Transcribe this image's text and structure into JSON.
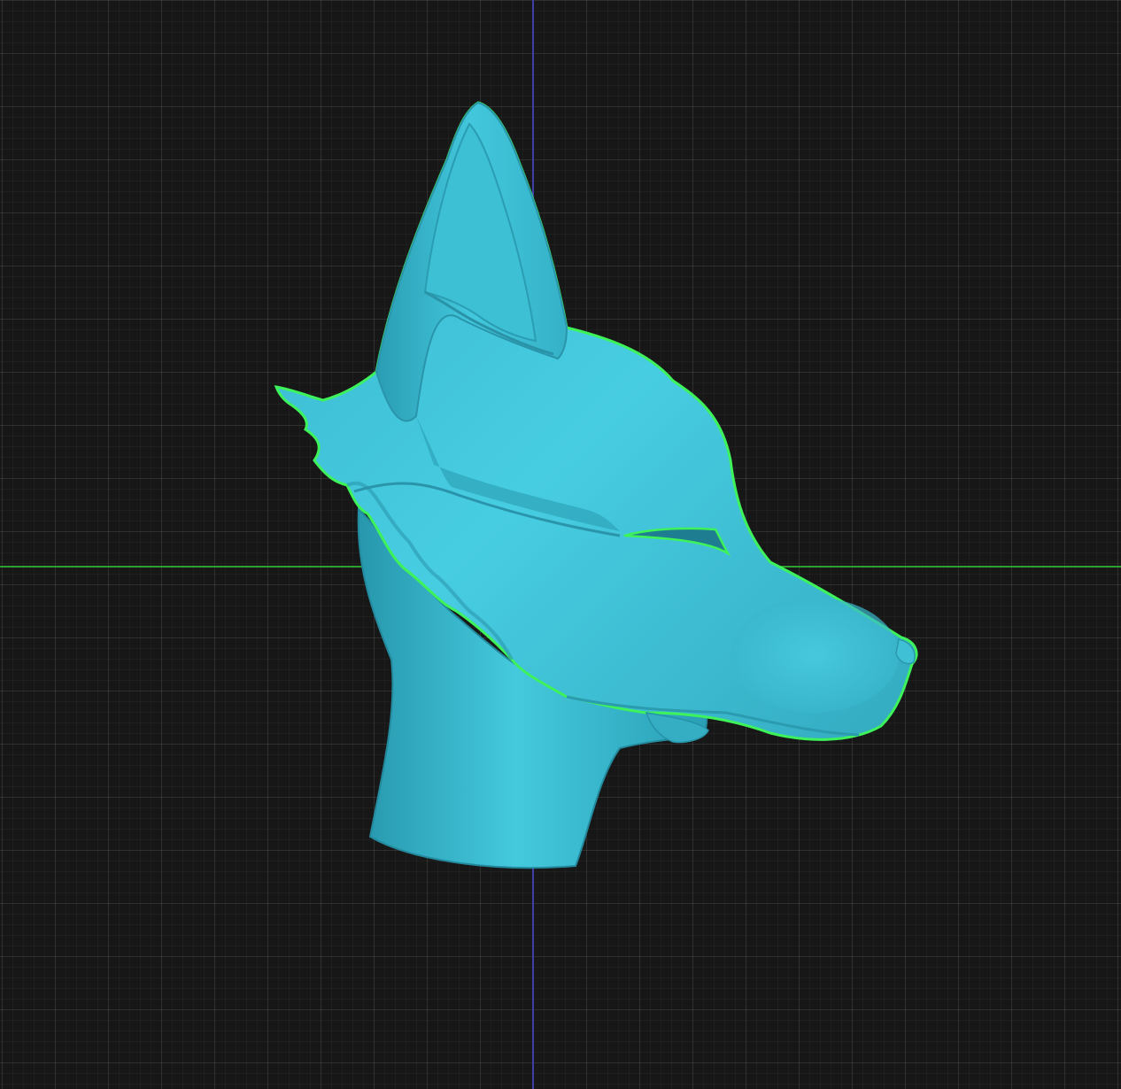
{
  "viewport": {
    "grid": true,
    "background_color": "#171717",
    "x_axis_color": "#2fa02f",
    "y_axis_color": "#3f3fa8"
  },
  "model": {
    "subject": "wolf-head",
    "view": "side-profile",
    "surface_color": "#3fc3d8",
    "selection_outline_color": "#3df25a",
    "selected": true
  }
}
